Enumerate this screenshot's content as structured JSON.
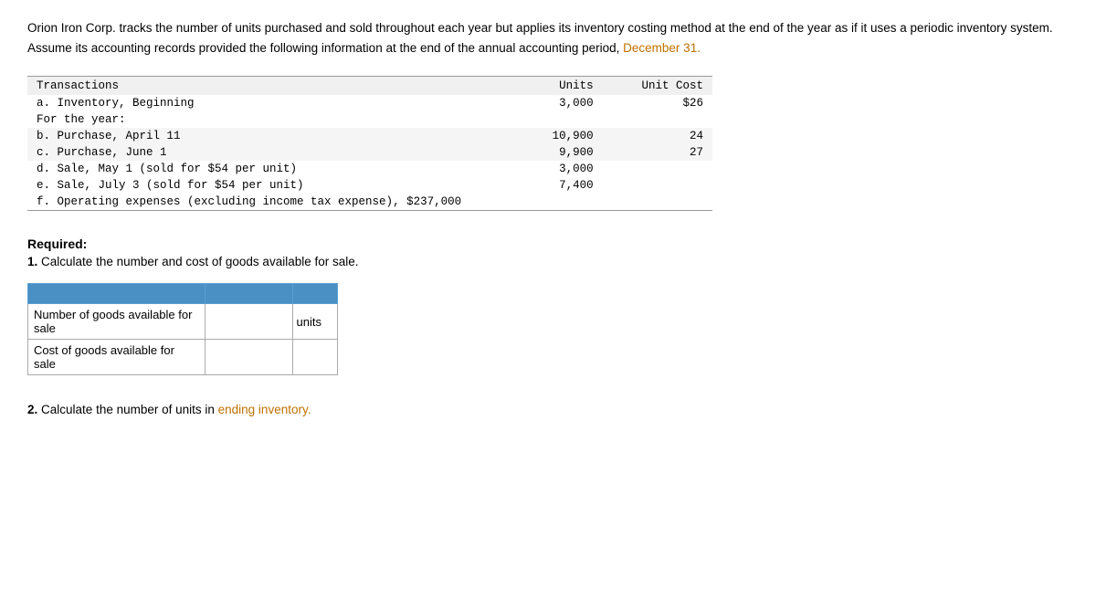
{
  "intro": {
    "text_before_highlight": "Orion Iron Corp. tracks the number of units purchased and sold throughout each year but applies its inventory costing method at the end of the year as if it uses a periodic inventory system. Assume its accounting records provided the following information at the end of the annual accounting period, ",
    "highlight": "December 31.",
    "text_after_highlight": ""
  },
  "table": {
    "col_transactions": "Transactions",
    "col_units": "Units",
    "col_unit_cost": "Unit Cost",
    "rows": [
      {
        "label": "a. Inventory, Beginning",
        "units": "3,000",
        "unit_cost": "$26",
        "shaded": false
      },
      {
        "label": "For the year:",
        "units": "",
        "unit_cost": "",
        "shaded": false
      },
      {
        "label": "b. Purchase, April 11",
        "units": "10,900",
        "unit_cost": "24",
        "shaded": true
      },
      {
        "label": "c. Purchase, June 1",
        "units": "9,900",
        "unit_cost": "27",
        "shaded": true
      },
      {
        "label": "d. Sale, May 1 (sold for $54 per unit)",
        "units": "3,000",
        "unit_cost": "",
        "shaded": false
      },
      {
        "label": "e. Sale, July 3 (sold for $54 per unit)",
        "units": "7,400",
        "unit_cost": "",
        "shaded": false
      },
      {
        "label": "f. Operating expenses (excluding income tax expense), $237,000",
        "units": "",
        "unit_cost": "",
        "shaded": false
      }
    ]
  },
  "required": {
    "label": "Required:",
    "instruction_num": "1.",
    "instruction_text": "Calculate the number and cost of goods available for sale."
  },
  "input_table": {
    "rows": [
      {
        "label": "Number of goods available for sale",
        "input_value": "",
        "units_label": "units"
      },
      {
        "label": "Cost of goods available for sale",
        "input_value": "",
        "units_label": ""
      }
    ]
  },
  "section2": {
    "num": "2.",
    "text_before_highlight": "Calculate the number of units in ",
    "highlight": "ending inventory.",
    "text_after_highlight": ""
  }
}
